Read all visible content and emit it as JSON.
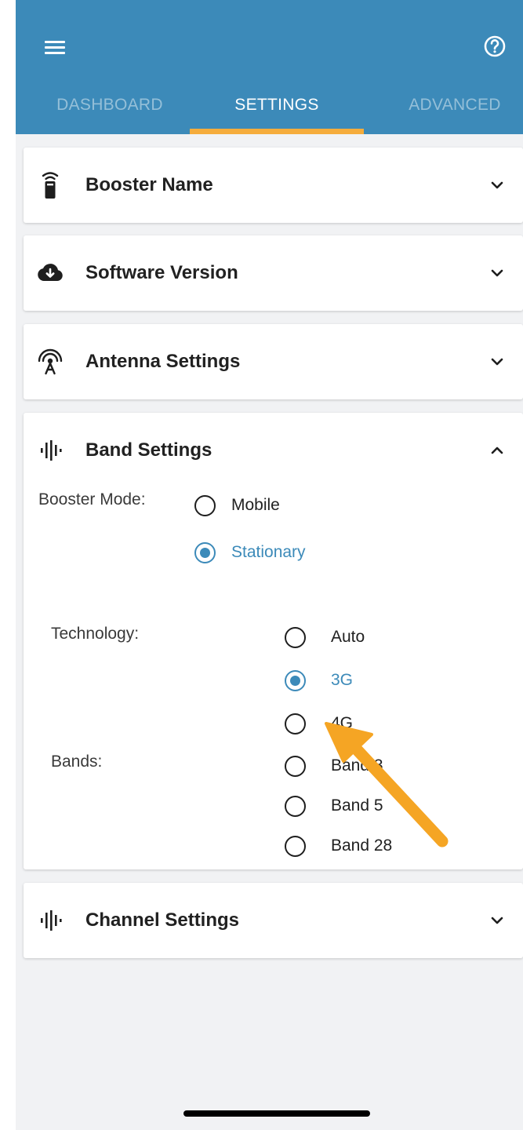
{
  "tabs": {
    "dashboard": "DASHBOARD",
    "settings": "SETTINGS",
    "advanced": "ADVANCED"
  },
  "sections": {
    "booster_name": "Booster Name",
    "software_version": "Software Version",
    "antenna_settings": "Antenna Settings",
    "band_settings": "Band Settings",
    "channel_settings": "Channel Settings"
  },
  "band_settings": {
    "booster_mode_label": "Booster Mode:",
    "modes": [
      "Mobile",
      "Stationary"
    ],
    "selected_mode": "Stationary",
    "technology_label": "Technology:",
    "technologies": [
      "Auto",
      "3G",
      "4G"
    ],
    "selected_technology": "3G",
    "bands_label": "Bands:",
    "bands": [
      "Band 3",
      "Band 5",
      "Band 28"
    ]
  },
  "colors": {
    "primary": "#3c8ab9",
    "tab_indicator": "#f5ac3c",
    "arrow": "#f5a524"
  },
  "icons": {
    "menu": "menu-icon",
    "help": "help-circle-icon",
    "booster": "booster-device-icon",
    "software": "cloud-download-icon",
    "antenna": "antenna-icon",
    "band": "signal-bars-icon",
    "channel": "signal-bars-icon",
    "expand": "chevron-down-icon",
    "collapse": "chevron-up-icon"
  }
}
